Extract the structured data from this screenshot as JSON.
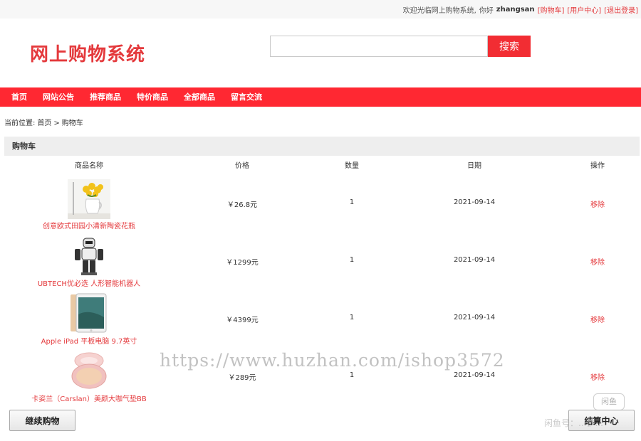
{
  "topbar": {
    "welcome": "欢迎光临网上购物系统,",
    "greeting": "你好",
    "username": "zhangsan",
    "links": [
      "[购物车]",
      "[用户中心]",
      "[退出登录]"
    ]
  },
  "header": {
    "logo": "网上购物系统",
    "search_placeholder": "",
    "search_button": "搜索"
  },
  "nav": [
    "首页",
    "网站公告",
    "推荐商品",
    "特价商品",
    "全部商品",
    "留言交流"
  ],
  "breadcrumb": {
    "label": "当前位置:",
    "home": "首页",
    "sep": ">",
    "current": "购物车"
  },
  "cart": {
    "title": "购物车",
    "columns": [
      "商品名称",
      "价格",
      "数量",
      "日期",
      "操作"
    ],
    "rows": [
      {
        "name": "创意欧式田园小清新陶瓷花瓶",
        "price": "￥26.8元",
        "qty": "1",
        "date": "2021-09-14",
        "action": "移除",
        "icon": "vase-image"
      },
      {
        "name": "UBTECH优必选 人形智能机器人",
        "price": "￥1299元",
        "qty": "1",
        "date": "2021-09-14",
        "action": "移除",
        "icon": "robot-image"
      },
      {
        "name": "Apple iPad 平板电脑 9.7英寸",
        "price": "￥4399元",
        "qty": "1",
        "date": "2021-09-14",
        "action": "移除",
        "icon": "tablet-image"
      },
      {
        "name": "卡姿兰（Carslan）美颜大咖气垫BB",
        "price": "￥289元",
        "qty": "1",
        "date": "2021-09-14",
        "action": "移除",
        "icon": "cushion-compact-image"
      }
    ]
  },
  "buttons": {
    "continue": "继续购物",
    "checkout": "结算中心"
  },
  "watermark": {
    "url": "https://www.huzhan.com/ishop3572",
    "badge": "闲鱼",
    "text": "闲鱼号：...铲..."
  },
  "colors": {
    "accent": "#e4393c",
    "nav_bg": "#ff2832",
    "search_btn": "#f22d33"
  }
}
